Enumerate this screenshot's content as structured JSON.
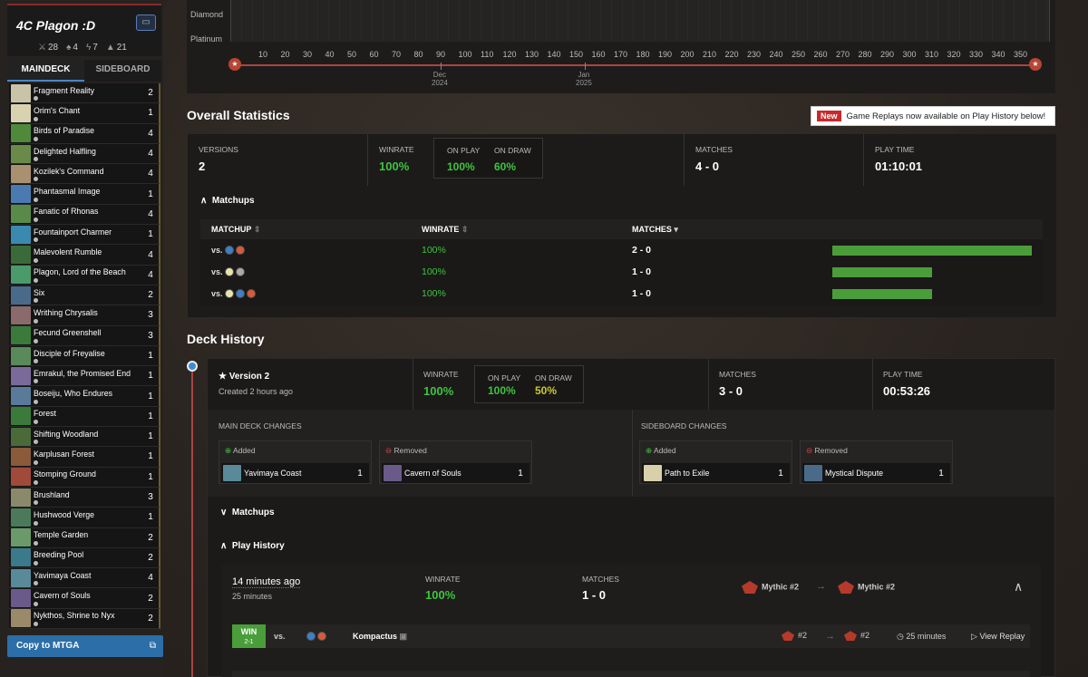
{
  "deck": {
    "name": "4C Plagon :D",
    "counts": {
      "creatures": "28",
      "lands": "4",
      "spells": "7",
      "other": "21"
    },
    "tabs": [
      "MAINDECK",
      "SIDEBOARD"
    ],
    "copy_label": "Copy to MTGA"
  },
  "cards": [
    {
      "name": "Fragment Reality",
      "qty": "2",
      "color": "#c9c4a8"
    },
    {
      "name": "Orim's Chant",
      "qty": "1",
      "color": "#d9d2b0"
    },
    {
      "name": "Birds of Paradise",
      "qty": "4",
      "color": "#4e8a3a"
    },
    {
      "name": "Delighted Halfling",
      "qty": "4",
      "color": "#6a8a4a"
    },
    {
      "name": "Kozilek's Command",
      "qty": "4",
      "color": "#a89070"
    },
    {
      "name": "Phantasmal Image",
      "qty": "1",
      "color": "#4a7ab0"
    },
    {
      "name": "Fanatic of Rhonas",
      "qty": "4",
      "color": "#5a8a4a"
    },
    {
      "name": "Fountainport Charmer",
      "qty": "1",
      "color": "#3a8ab0"
    },
    {
      "name": "Malevolent Rumble",
      "qty": "4",
      "color": "#3a6a3a"
    },
    {
      "name": "Plagon, Lord of the Beach",
      "qty": "4",
      "color": "#4a9a6a"
    },
    {
      "name": "Six",
      "qty": "2",
      "color": "#4a6a8a"
    },
    {
      "name": "Writhing Chrysalis",
      "qty": "3",
      "color": "#8a6a6a"
    },
    {
      "name": "Fecund Greenshell",
      "qty": "3",
      "color": "#3a7a3a"
    },
    {
      "name": "Disciple of Freyalise",
      "qty": "1",
      "color": "#5a8a5a"
    },
    {
      "name": "Emrakul, the Promised End",
      "qty": "1",
      "color": "#7a6a9a"
    },
    {
      "name": "Boseiju, Who Endures",
      "qty": "1",
      "color": "#5a7a9a"
    },
    {
      "name": "Forest",
      "qty": "1",
      "color": "#3a7a3a"
    },
    {
      "name": "Shifting Woodland",
      "qty": "1",
      "color": "#4a6a3a"
    },
    {
      "name": "Karplusan Forest",
      "qty": "1",
      "color": "#8a5a3a"
    },
    {
      "name": "Stomping Ground",
      "qty": "1",
      "color": "#a04a3a"
    },
    {
      "name": "Brushland",
      "qty": "3",
      "color": "#8a8a6a"
    },
    {
      "name": "Hushwood Verge",
      "qty": "1",
      "color": "#4a7a5a"
    },
    {
      "name": "Temple Garden",
      "qty": "2",
      "color": "#6a9a6a"
    },
    {
      "name": "Breeding Pool",
      "qty": "2",
      "color": "#3a7a8a"
    },
    {
      "name": "Yavimaya Coast",
      "qty": "4",
      "color": "#5a8a9a"
    },
    {
      "name": "Cavern of Souls",
      "qty": "2",
      "color": "#6a5a8a"
    },
    {
      "name": "Nykthos, Shrine to Nyx",
      "qty": "2",
      "color": "#9a8a6a"
    }
  ],
  "chart": {
    "ranks": [
      "Diamond",
      "Platinum"
    ],
    "ticks": [
      "10",
      "20",
      "30",
      "40",
      "50",
      "60",
      "70",
      "80",
      "90",
      "100",
      "110",
      "120",
      "130",
      "140",
      "150",
      "160",
      "170",
      "180",
      "190",
      "200",
      "210",
      "220",
      "230",
      "240",
      "250",
      "260",
      "270",
      "280",
      "290",
      "300",
      "310",
      "320",
      "330",
      "340",
      "350"
    ],
    "dates": [
      {
        "line1": "Dec",
        "line2": "2024"
      },
      {
        "line1": "Jan",
        "line2": "2025"
      }
    ]
  },
  "overall": {
    "title": "Overall Statistics",
    "notice_new": "New",
    "notice_text": "Game Replays now available on Play History below!",
    "versions_label": "VERSIONS",
    "versions": "2",
    "winrate_label": "WINRATE",
    "winrate": "100%",
    "onplay_label": "ON PLAY",
    "onplay": "100%",
    "ondraw_label": "ON DRAW",
    "ondraw": "60%",
    "matches_label": "MATCHES",
    "matches": "4 - 0",
    "playtime_label": "PLAY TIME",
    "playtime": "01:10:01"
  },
  "matchups": {
    "title": "Matchups",
    "headers": {
      "matchup": "MATCHUP",
      "winrate": "WINRATE",
      "matches": "MATCHES"
    },
    "rows": [
      {
        "vs": "vs.",
        "winrate": "100%",
        "matches": "2 - 0",
        "bar": 1.0
      },
      {
        "vs": "vs.",
        "winrate": "100%",
        "matches": "1 - 0",
        "bar": 0.5
      },
      {
        "vs": "vs.",
        "winrate": "100%",
        "matches": "1 - 0",
        "bar": 0.5
      }
    ]
  },
  "history": {
    "title": "Deck History",
    "version": "Version 2",
    "created": "Created 2 hours ago",
    "winrate_label": "WINRATE",
    "winrate": "100%",
    "onplay_label": "ON PLAY",
    "onplay": "100%",
    "ondraw_label": "ON DRAW",
    "ondraw": "50%",
    "matches_label": "MATCHES",
    "matches": "3 - 0",
    "playtime_label": "PLAY TIME",
    "playtime": "00:53:26",
    "main_changes": "MAIN DECK CHANGES",
    "side_changes": "SIDEBOARD CHANGES",
    "added": "Added",
    "removed": "Removed",
    "main_added": {
      "name": "Yavimaya Coast",
      "qty": "1"
    },
    "main_removed": {
      "name": "Cavern of Souls",
      "qty": "1"
    },
    "side_added": {
      "name": "Path to Exile",
      "qty": "1"
    },
    "side_removed": {
      "name": "Mystical Dispute",
      "qty": "1"
    },
    "matchups_label": "Matchups",
    "playhistory_label": "Play History"
  },
  "play": {
    "time": "14 minutes ago",
    "duration": "25 minutes",
    "winrate_label": "WINRATE",
    "winrate": "100%",
    "matches_label": "MATCHES",
    "matches": "1 - 0",
    "rank_from": "Mythic #2",
    "rank_to": "Mythic #2",
    "game": {
      "result": "WIN",
      "score": "2-1",
      "vs": "vs.",
      "opponent": "Kompactus",
      "from": "#2",
      "to": "#2",
      "duration": "25 minutes",
      "replay": "View Replay"
    }
  }
}
